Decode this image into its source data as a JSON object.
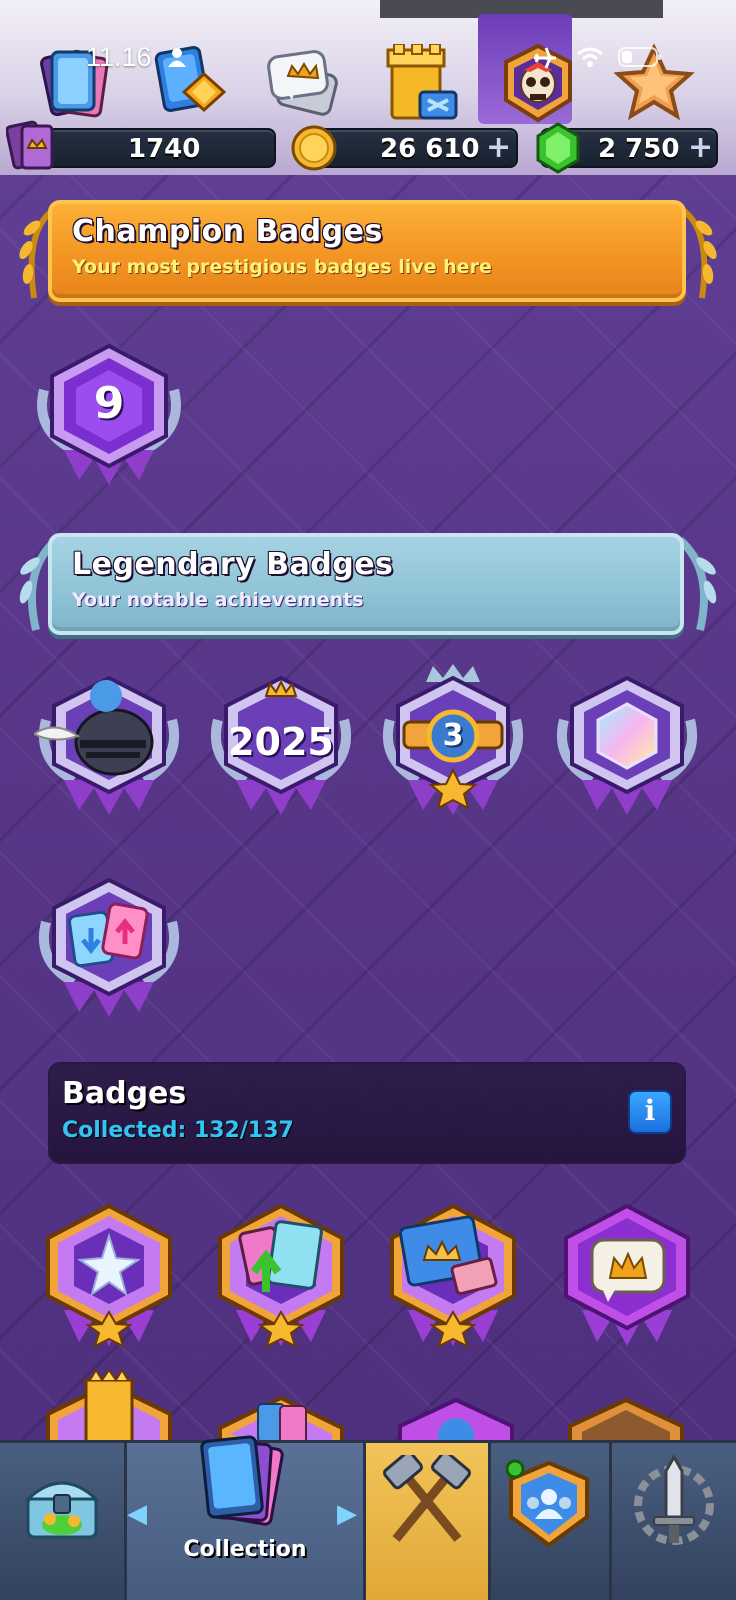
{
  "status_bar": {
    "time": "11.16"
  },
  "currencies": {
    "trophies": "1740",
    "gold": "26 610",
    "gems": "2 750",
    "plus_symbol": "+"
  },
  "champion_section": {
    "title": "Champion Badges",
    "subtitle": "Your most prestigious badges live here",
    "badges": [
      {
        "label": "9"
      }
    ]
  },
  "legendary_section": {
    "title": "Legendary Badges",
    "subtitle": "Your notable achievements",
    "badges": [
      {
        "icon": "knight-helmet-icon"
      },
      {
        "label": "2025"
      },
      {
        "label": "3"
      },
      {
        "icon": "gem-icon"
      },
      {
        "icon": "card-trade-icon"
      }
    ]
  },
  "badges_panel": {
    "title": "Badges",
    "collected": "Collected: 132/137",
    "info_label": "i"
  },
  "bottom_nav": {
    "items": [
      {
        "name": "Shop",
        "icon": "chest-icon"
      },
      {
        "name": "Collection",
        "label": "Collection",
        "icon": "cards-icon"
      },
      {
        "name": "Battle",
        "icon": "crossed-hammers-icon"
      },
      {
        "name": "Clan",
        "icon": "clan-icon"
      },
      {
        "name": "Events",
        "icon": "sword-icon"
      }
    ]
  },
  "colors": {
    "background": "#5b3a8f",
    "champion_banner": "#f39523",
    "legendary_banner": "#8fc3d6",
    "collected_text": "#33c4f2",
    "nav_selected": "#e1a737"
  }
}
